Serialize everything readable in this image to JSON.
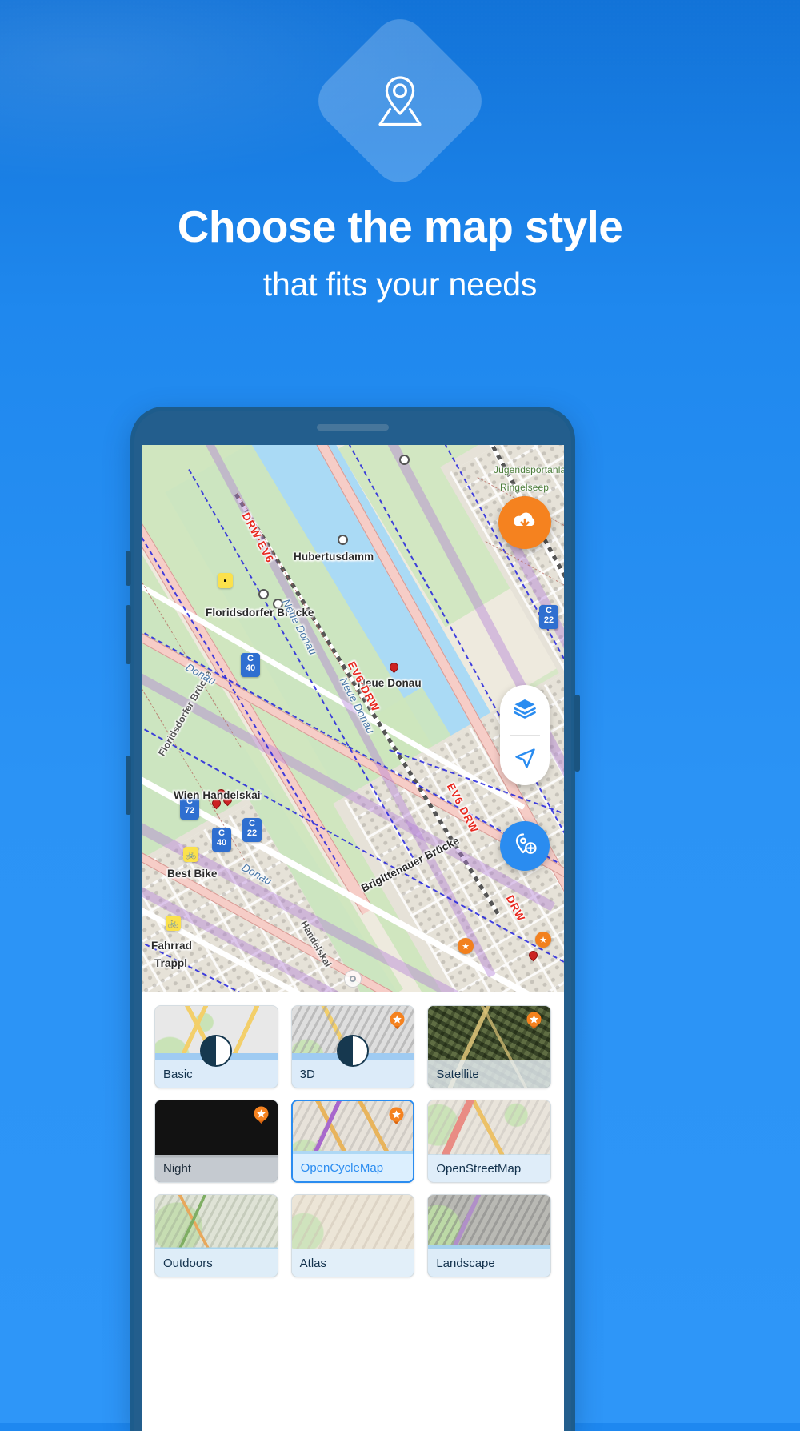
{
  "theme": {
    "brand_blue": "#2a8cf0",
    "accent_orange": "#f5821f",
    "bezel_blue": "#1d5c8c",
    "selected_blue": "#2a8cf0"
  },
  "promo": {
    "headline": "Choose the map style",
    "subheadline": "that fits your needs",
    "logo_icon": "map-pin-on-map-icon"
  },
  "map": {
    "labels": [
      {
        "text": "Hubertusdamm",
        "kind": "place"
      },
      {
        "text": "Floridsdorfer Brücke",
        "kind": "place"
      },
      {
        "text": "Neue Donau",
        "kind": "place"
      },
      {
        "text": "Wien Handelskai",
        "kind": "place"
      },
      {
        "text": "Best Bike",
        "kind": "poi"
      },
      {
        "text": "Fahrrad",
        "kind": "poi"
      },
      {
        "text": "Trappl",
        "kind": "poi"
      },
      {
        "text": "Brigittenauer Brücke",
        "kind": "bridge"
      },
      {
        "text": "Floridsdorfer Brücke",
        "kind": "bridge"
      },
      {
        "text": "Handelskai",
        "kind": "street"
      },
      {
        "text": "Donau",
        "kind": "water"
      },
      {
        "text": "Neue Donau",
        "kind": "water"
      },
      {
        "text": "Neue Donau",
        "kind": "water"
      },
      {
        "text": "Jugendsportanlage",
        "kind": "green"
      },
      {
        "text": "Ringelseep",
        "kind": "green"
      },
      {
        "text": "Donau",
        "kind": "water"
      }
    ],
    "routes": [
      {
        "text": "DRW·EV6"
      },
      {
        "text": "EV6·DRW"
      },
      {
        "text": "EV6 DRW"
      },
      {
        "text": "DRW"
      }
    ],
    "cycle_nodes": [
      {
        "letter": "C",
        "number": "40"
      },
      {
        "letter": "C",
        "number": "22"
      },
      {
        "letter": "C",
        "number": "72"
      },
      {
        "letter": "C",
        "number": "40"
      },
      {
        "letter": "C",
        "number": "22"
      }
    ],
    "controls": [
      {
        "name": "download-offline-maps-button",
        "icon": "cloud-download-icon"
      },
      {
        "name": "map-layers-button",
        "icon": "layers-icon"
      },
      {
        "name": "my-location-button",
        "icon": "navigation-arrow-icon"
      },
      {
        "name": "add-waypoint-button",
        "icon": "add-marker-icon"
      },
      {
        "name": "compass-button",
        "icon": "compass-icon"
      }
    ]
  },
  "style_picker": {
    "tiles": [
      {
        "id": "basic",
        "label": "Basic",
        "thumb": "th-basic",
        "pro": false,
        "selected": false,
        "contrast_toggle": true,
        "dark": false
      },
      {
        "id": "3d",
        "label": "3D",
        "thumb": "th-3d",
        "pro": true,
        "selected": false,
        "contrast_toggle": true,
        "dark": false
      },
      {
        "id": "satellite",
        "label": "Satellite",
        "thumb": "th-satellite",
        "pro": true,
        "selected": false,
        "contrast_toggle": false,
        "dark": false
      },
      {
        "id": "night",
        "label": "Night",
        "thumb": "th-night",
        "pro": true,
        "selected": false,
        "contrast_toggle": false,
        "dark": true
      },
      {
        "id": "opencyclemap",
        "label": "OpenCycleMap",
        "thumb": "th-cycle",
        "pro": true,
        "selected": true,
        "contrast_toggle": false,
        "dark": false
      },
      {
        "id": "openstreetmap",
        "label": "OpenStreetMap",
        "thumb": "th-osm",
        "pro": false,
        "selected": false,
        "contrast_toggle": false,
        "dark": false
      },
      {
        "id": "outdoors",
        "label": "Outdoors",
        "thumb": "th-outdoors",
        "pro": false,
        "selected": false,
        "contrast_toggle": false,
        "dark": false
      },
      {
        "id": "atlas",
        "label": "Atlas",
        "thumb": "th-atlas",
        "pro": false,
        "selected": false,
        "contrast_toggle": false,
        "dark": false
      },
      {
        "id": "landscape",
        "label": "Landscape",
        "thumb": "th-landscape",
        "pro": false,
        "selected": false,
        "contrast_toggle": false,
        "dark": false
      }
    ]
  }
}
